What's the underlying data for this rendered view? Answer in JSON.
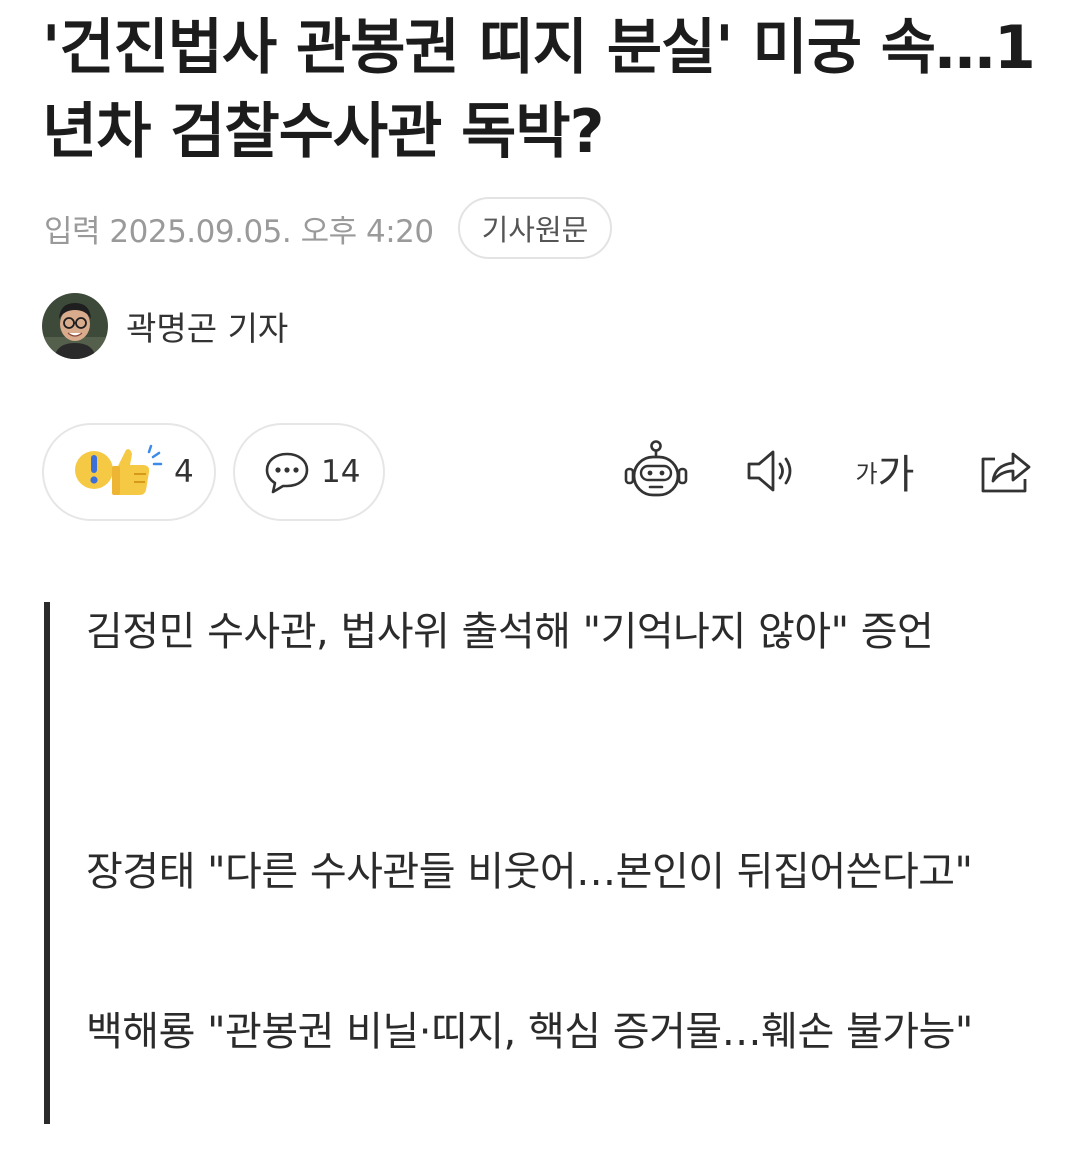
{
  "article": {
    "headline": "'건진법사 관봉권 띠지 분실' 미궁 속…1년차 검찰수사관 독박?",
    "published": "입력 2025.09.05. 오후 4:20",
    "source_button": "기사원문",
    "reporter": "곽명곤 기자"
  },
  "actions": {
    "reaction_icon": "exclaim-thumbs-up-icon",
    "reaction_count": "4",
    "comment_icon": "comment-bubble-icon",
    "comment_count": "14",
    "tools": [
      {
        "name": "robot-summary-icon"
      },
      {
        "name": "speaker-icon"
      },
      {
        "name": "font-size-icon",
        "small": "가",
        "big": "가"
      },
      {
        "name": "share-icon"
      }
    ]
  },
  "summary": [
    "김정민 수사관, 법사위 출석해 \"기억나지 않아\" 증언",
    "장경태 \"다른 수사관들 비웃어…본인이 뒤집어쓴다고\"",
    "백해룡 \"관봉권 비닐·띠지, 핵심 증거물…훼손 불가능\""
  ],
  "colors": {
    "text": "#1c1c1c",
    "muted": "#9a9a9a",
    "border": "#e6e6e6",
    "quote_bar": "#2b2b2b",
    "reaction_yellow": "#f6c945",
    "reaction_blue": "#3c8be8"
  }
}
